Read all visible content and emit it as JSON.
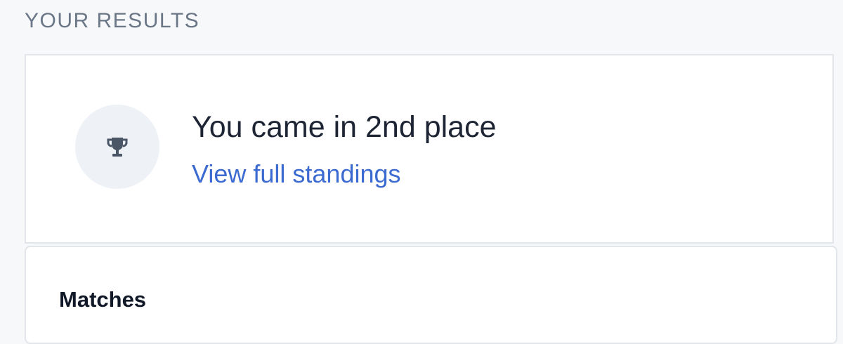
{
  "results": {
    "heading": "YOUR RESULTS",
    "placement_text": "You came in 2nd place",
    "standings_link": "View full standings",
    "icon": "trophy-icon"
  },
  "matches": {
    "title": "Matches"
  },
  "colors": {
    "background": "#f7f8fa",
    "heading": "#6b7787",
    "title": "#1d2433",
    "link": "#3b6ad1",
    "icon": "#4a5566",
    "icon_circle": "#eef1f6"
  }
}
